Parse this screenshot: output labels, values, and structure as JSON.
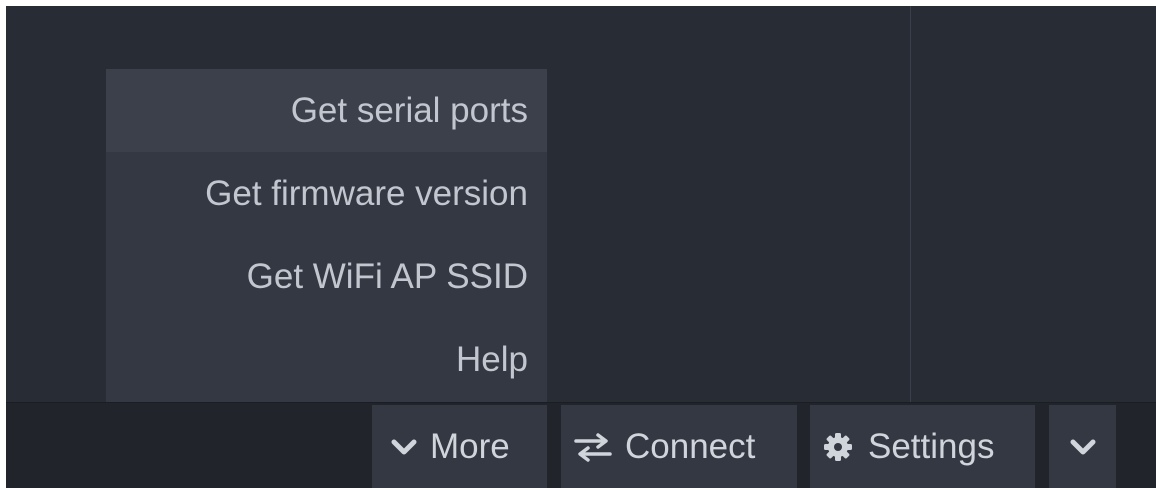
{
  "menu": {
    "items": [
      {
        "label": "Get serial ports"
      },
      {
        "label": "Get firmware version"
      },
      {
        "label": "Get WiFi AP SSID"
      },
      {
        "label": "Help"
      }
    ]
  },
  "toolbar": {
    "more": {
      "label": "More",
      "icon": "chevron-down-icon"
    },
    "connect": {
      "label": "Connect",
      "icon": "swap-arrows-icon"
    },
    "settings": {
      "label": "Settings",
      "icon": "gear-icon"
    },
    "expand": {
      "icon": "chevron-down-icon"
    }
  },
  "colors": {
    "editor_bg": "#282c34",
    "menu_bg": "#333842",
    "menu_highlight": "#3b404b",
    "text": "#c2c6ce"
  }
}
